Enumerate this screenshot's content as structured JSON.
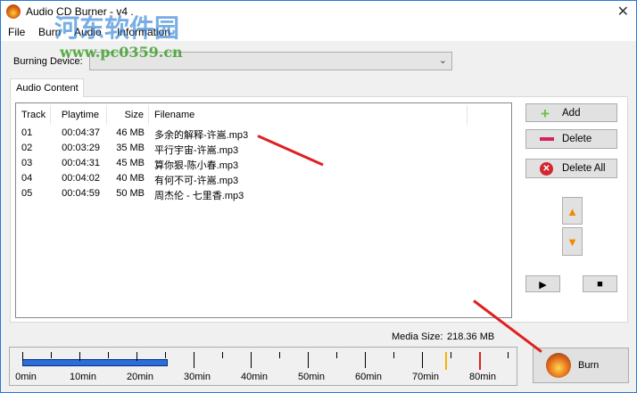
{
  "window": {
    "title": "Audio CD Burner - v4 .",
    "close": "✕"
  },
  "menu": [
    "File",
    "Burn",
    "Audio",
    "Information"
  ],
  "device": {
    "label": "Burning Device:",
    "value": ""
  },
  "tab": "Audio Content",
  "columns": [
    "Track",
    "Playtime",
    "Size",
    "Filename"
  ],
  "rows": [
    {
      "track": "01",
      "time": "00:04:37",
      "size": "46 MB",
      "file": "多余的解释-许嵩.mp3"
    },
    {
      "track": "02",
      "time": "00:03:29",
      "size": "35 MB",
      "file": "平行宇宙-许嵩.mp3"
    },
    {
      "track": "03",
      "time": "00:04:31",
      "size": "45 MB",
      "file": "算你狠-陈小春.mp3"
    },
    {
      "track": "04",
      "time": "00:04:02",
      "size": "40 MB",
      "file": "有何不可-许嵩.mp3"
    },
    {
      "track": "05",
      "time": "00:04:59",
      "size": "50 MB",
      "file": "周杰伦 - 七里香.mp3"
    }
  ],
  "buttons": {
    "add": "Add",
    "delete": "Delete",
    "delete_all": "Delete All",
    "up": "▲",
    "down": "▼",
    "play": "▶",
    "stop": "■",
    "burn": "Burn"
  },
  "media": {
    "label": "Media Size:",
    "value": "218.36 MB"
  },
  "timeline": {
    "labels": [
      "0min",
      "10min",
      "20min",
      "30min",
      "40min",
      "50min",
      "60min",
      "70min",
      "80min"
    ],
    "used_minutes": 25.4,
    "max_minutes": 88,
    "warn_minutes": 74,
    "limit_minutes": 80,
    "fill_color": "#2b6fd6",
    "warn_color": "#f0b400",
    "limit_color": "#e02020"
  },
  "watermark": {
    "cn": "河东软件园",
    "url": "www.pc0359.cn"
  }
}
